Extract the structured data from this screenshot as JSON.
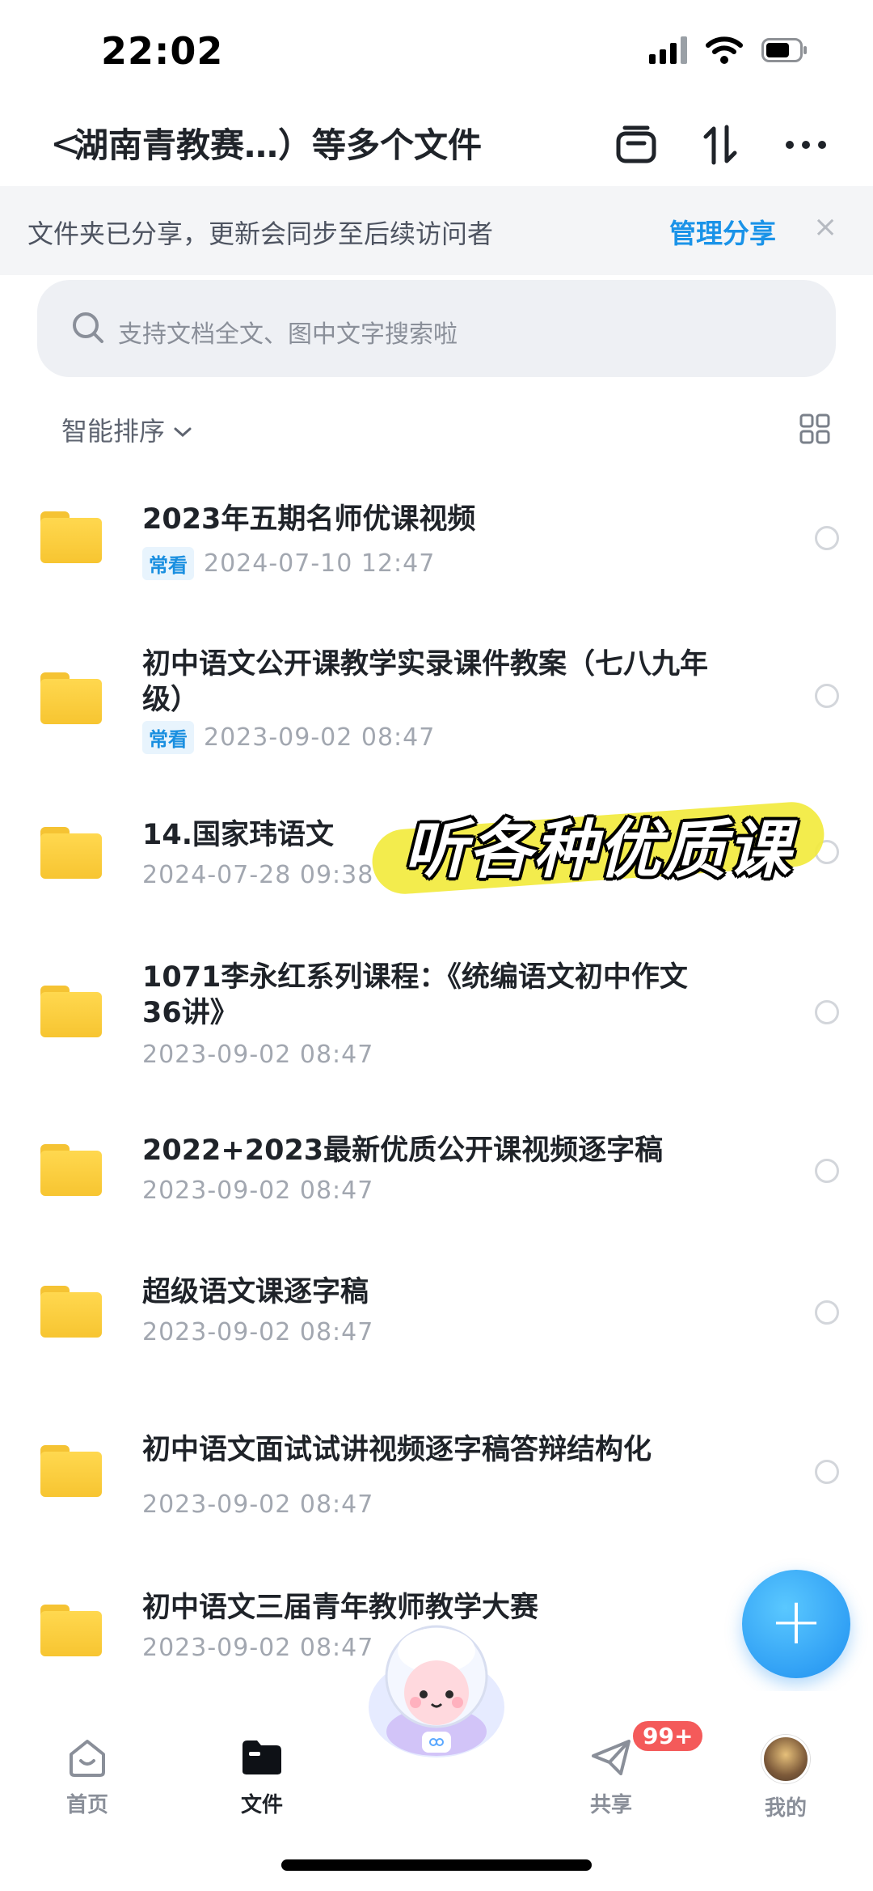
{
  "status_bar": {
    "time": "22:02"
  },
  "nav": {
    "back_symbol": "<",
    "title": "湖南青教赛…）等多个文件",
    "icons": [
      "archive-icon",
      "sort-arrows-icon",
      "more-icon"
    ]
  },
  "banner": {
    "text": "文件夹已分享，更新会同步至后续访问者",
    "link": "管理分享",
    "close": "×"
  },
  "search": {
    "placeholder": "支持文档全文、图中文字搜索啦"
  },
  "sort": {
    "label": "智能排序"
  },
  "files": [
    {
      "title": "2023年五期名师优课视频",
      "tag": "常看",
      "date": "2024-07-10 12:47"
    },
    {
      "title": "初中语文公开课教学实录课件教案（七八九年级）",
      "tag": "常看",
      "date": "2023-09-02 08:47"
    },
    {
      "title": "14.国家玮语文",
      "tag": "",
      "date": "2024-07-28 09:38"
    },
    {
      "title": "1071李永红系列课程：《统编语文初中作文36讲》",
      "tag": "",
      "date": "2023-09-02 08:47"
    },
    {
      "title": "2022+2023最新优质公开课视频逐字稿",
      "tag": "",
      "date": "2023-09-02 08:47"
    },
    {
      "title": "超级语文课逐字稿",
      "tag": "",
      "date": "2023-09-02 08:47"
    },
    {
      "title": "初中语文面试试讲视频逐字稿答辩结构化",
      "tag": "",
      "date": "2023-09-02 08:47"
    },
    {
      "title": "初中语文三届青年教师教学大赛",
      "tag": "",
      "date": "2023-09-02 08:47"
    }
  ],
  "overlay_caption": "听各种优质课",
  "fab": {
    "symbol": "+"
  },
  "tabbar": {
    "items": [
      {
        "label": "首页"
      },
      {
        "label": "文件"
      },
      {
        "label": "共享"
      },
      {
        "label": "我的"
      }
    ],
    "share_badge": "99+"
  },
  "colors": {
    "accent": "#1a93e8",
    "folder": "#f7c531",
    "badge": "#f45a5a"
  }
}
